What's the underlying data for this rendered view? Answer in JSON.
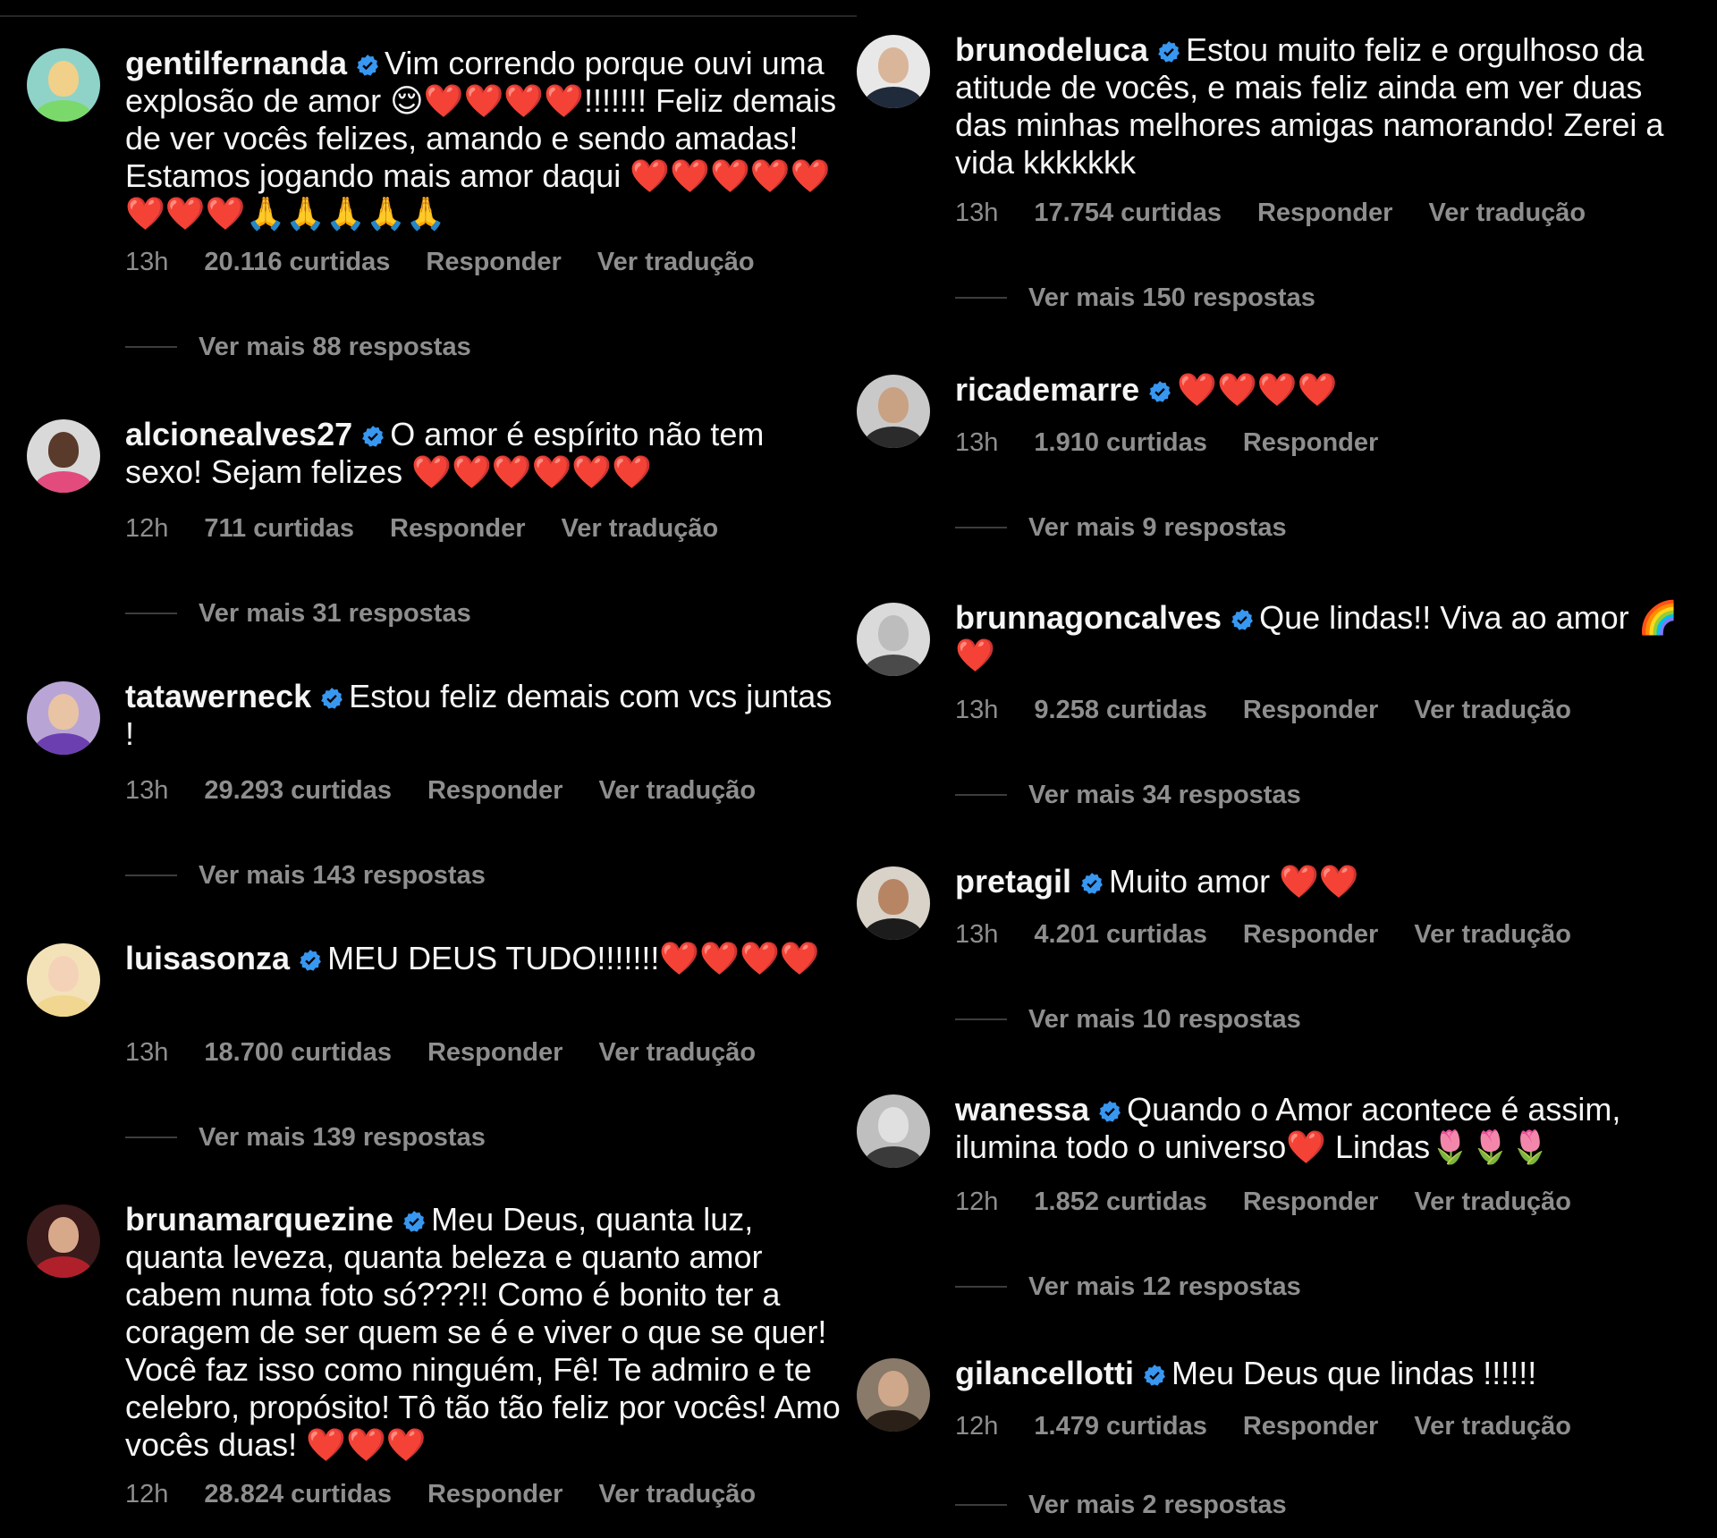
{
  "colors": {
    "background": "#000000",
    "text": "#f5f5f5",
    "muted": "#8e8e8e",
    "verified": "#3897f0"
  },
  "icons": {
    "verified": "verified-badge-icon"
  },
  "comments": [
    {
      "username": "gentilfernanda",
      "text": "Vim correndo porque ouvi uma explosão de amor 😌❤️❤️❤️❤️!!!!!!! Feliz demais de ver vocês felizes, amando e sendo amadas! Estamos jogando mais amor daqui ❤️❤️❤️❤️❤️❤️❤️❤️🙏🙏🙏🙏🙏",
      "time": "13h",
      "likes": "20.116 curtidas",
      "reply": "Responder",
      "translate": "Ver tradução",
      "view_replies": "Ver mais 88 respostas"
    },
    {
      "username": "alcionealves27",
      "text": "O amor é espírito não tem sexo! Sejam felizes ❤️❤️❤️❤️❤️❤️",
      "time": "12h",
      "likes": "711 curtidas",
      "reply": "Responder",
      "translate": "Ver tradução",
      "view_replies": "Ver mais 31 respostas"
    },
    {
      "username": "tatawerneck",
      "text": "Estou feliz demais com vcs juntas !",
      "time": "13h",
      "likes": "29.293 curtidas",
      "reply": "Responder",
      "translate": "Ver tradução",
      "view_replies": "Ver mais 143 respostas"
    },
    {
      "username": "luisasonza",
      "text": "MEU DEUS TUDO!!!!!!!❤️❤️❤️❤️",
      "time": "13h",
      "likes": "18.700 curtidas",
      "reply": "Responder",
      "translate": "Ver tradução",
      "view_replies": "Ver mais 139 respostas"
    },
    {
      "username": "brunamarquezine",
      "text": "Meu Deus, quanta luz, quanta leveza, quanta beleza e quanto amor cabem numa foto só???!! Como é bonito ter a coragem de ser quem se é e viver o que se quer! Você faz isso como ninguém, Fê! Te admiro e te celebro, propósito! Tô tão tão feliz por vocês! Amo vocês duas! ❤️❤️❤️",
      "time": "12h",
      "likes": "28.824 curtidas",
      "reply": "Responder",
      "translate": "Ver tradução"
    },
    {
      "username": "brunodeluca",
      "text": "Estou muito feliz e orgulhoso da atitude de vocês, e mais feliz ainda em ver duas das minhas melhores amigas namorando! Zerei a vida kkkkkkk",
      "time": "13h",
      "likes": "17.754 curtidas",
      "reply": "Responder",
      "translate": "Ver tradução",
      "view_replies": "Ver mais 150 respostas"
    },
    {
      "username": "ricademarre",
      "text": "❤️❤️❤️❤️",
      "time": "13h",
      "likes": "1.910 curtidas",
      "reply": "Responder",
      "view_replies": "Ver mais 9 respostas"
    },
    {
      "username": "brunnagoncalves",
      "text": "Que lindas!! Viva ao amor 🌈❤️",
      "time": "13h",
      "likes": "9.258 curtidas",
      "reply": "Responder",
      "translate": "Ver tradução",
      "view_replies": "Ver mais 34 respostas"
    },
    {
      "username": "pretagil",
      "text": "Muito amor ❤️❤️",
      "time": "13h",
      "likes": "4.201 curtidas",
      "reply": "Responder",
      "translate": "Ver tradução",
      "view_replies": "Ver mais 10 respostas"
    },
    {
      "username": "wanessa",
      "text": "Quando o Amor acontece é assim, ilumina todo o universo❤️ Lindas🌷🌷🌷",
      "time": "12h",
      "likes": "1.852 curtidas",
      "reply": "Responder",
      "translate": "Ver tradução",
      "view_replies": "Ver mais 12 respostas"
    },
    {
      "username": "gilancellotti",
      "text": "Meu Deus que lindas !!!!!!",
      "time": "12h",
      "likes": "1.479 curtidas",
      "reply": "Responder",
      "translate": "Ver tradução",
      "view_replies": "Ver mais 2 respostas"
    }
  ]
}
